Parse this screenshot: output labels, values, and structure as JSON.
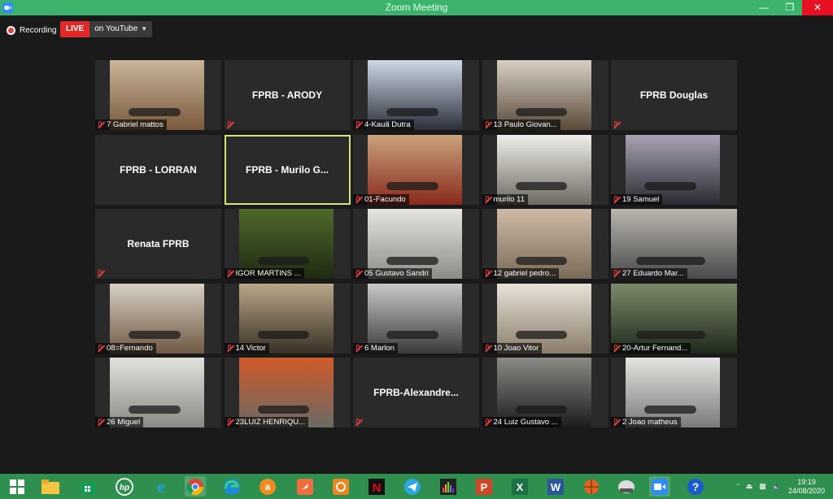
{
  "window": {
    "title": "Zoom Meeting"
  },
  "toolbar": {
    "recording_label": "Recording",
    "live_label": "LIVE",
    "live_target": "on YouTube"
  },
  "participants": [
    {
      "name": "7 Gabriel mattos",
      "video": true,
      "muted": true
    },
    {
      "name": "FPRB - ARODY",
      "video": false,
      "muted": true
    },
    {
      "name": "4-Kauã Dutra",
      "video": true,
      "muted": true
    },
    {
      "name": "13 Paulo Giovan...",
      "video": true,
      "muted": true
    },
    {
      "name": "FPRB Douglas",
      "video": false,
      "muted": true
    },
    {
      "name": "FPRB - LORRAN",
      "video": false,
      "muted": false
    },
    {
      "name": "FPRB - Murilo G...",
      "video": false,
      "muted": false,
      "active_speaker": true
    },
    {
      "name": "01-Facundo",
      "video": true,
      "muted": true
    },
    {
      "name": "murilo 11",
      "video": true,
      "muted": true
    },
    {
      "name": "19 Samuel",
      "video": true,
      "muted": true
    },
    {
      "name": "Renata FPRB",
      "video": false,
      "muted": true
    },
    {
      "name": "IGOR MARTINS ...",
      "video": true,
      "muted": true
    },
    {
      "name": "05 Gustavo Sandri",
      "video": true,
      "muted": true
    },
    {
      "name": "12 gabriel pedro...",
      "video": true,
      "muted": true
    },
    {
      "name": "27 Eduardo Mar...",
      "video": true,
      "muted": true
    },
    {
      "name": "08=Fernando",
      "video": true,
      "muted": true
    },
    {
      "name": "14 Victor",
      "video": true,
      "muted": true
    },
    {
      "name": "6 Marlon",
      "video": true,
      "muted": true
    },
    {
      "name": "10 Joao Vitor",
      "video": true,
      "muted": true
    },
    {
      "name": "20-Artur Fernand...",
      "video": true,
      "muted": true
    },
    {
      "name": "26 Miguel",
      "video": true,
      "muted": true
    },
    {
      "name": "23LUIZ HENRIQU...",
      "video": true,
      "muted": true
    },
    {
      "name": "FPRB-Alexandre...",
      "video": false,
      "muted": true
    },
    {
      "name": "24 Luiz Gustavo ...",
      "video": true,
      "muted": true
    },
    {
      "name": "2 Joao matheus",
      "video": true,
      "muted": true
    }
  ],
  "taskbar": {
    "items": [
      "windows-start",
      "file-explorer",
      "store",
      "hp",
      "internet-explorer",
      "chrome",
      "edge",
      "avast",
      "rocket-app",
      "camera-app",
      "netflix",
      "telegram",
      "audio-app",
      "powerpoint",
      "excel",
      "word",
      "basketball-app",
      "inkscape",
      "zoom",
      "help"
    ],
    "time": "19:19",
    "date": "24/08/2020"
  },
  "colors": {
    "titlebar": "#3bb36b",
    "taskbar": "#2f8f4f",
    "live": "#e02828",
    "active_speaker": "#d8e27d",
    "muted": "#e23c3c"
  }
}
